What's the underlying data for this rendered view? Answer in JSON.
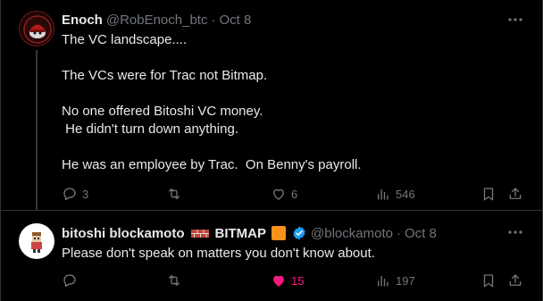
{
  "tweets": [
    {
      "name": "Enoch",
      "handle": "@RobEnoch_btc",
      "separator": "·",
      "date": "Oct 8",
      "text": "The VC landscape....\n\nThe VCs were for Trac not Bitmap.\n\nNo one offered Bitoshi VC money.\n He didn't turn down anything.\n\nHe was an employee by Trac.  On Benny's payroll.",
      "replies": "3",
      "retweets": "",
      "likes": "6",
      "views": "546"
    },
    {
      "name": "bitoshi blockamoto",
      "name_suffix": "BITMAP",
      "handle": "@blockamoto",
      "separator": "·",
      "date": "Oct 8",
      "text": "Please don't speak on matters you don't know about.",
      "replies": "",
      "retweets": "",
      "likes": "15",
      "views": "197",
      "liked_color": "#f91880"
    }
  ],
  "icons": [
    "more-icon",
    "reply-icon",
    "retweet-icon",
    "like-icon",
    "views-icon",
    "bookmark-icon",
    "share-icon",
    "verified-icon",
    "brick-icon"
  ],
  "colors": {
    "background": "#000000",
    "text": "#e7e9ea",
    "muted": "#71767b",
    "like": "#f91880",
    "verified": "#1d9bf0",
    "bitmap": "#f7931a"
  }
}
